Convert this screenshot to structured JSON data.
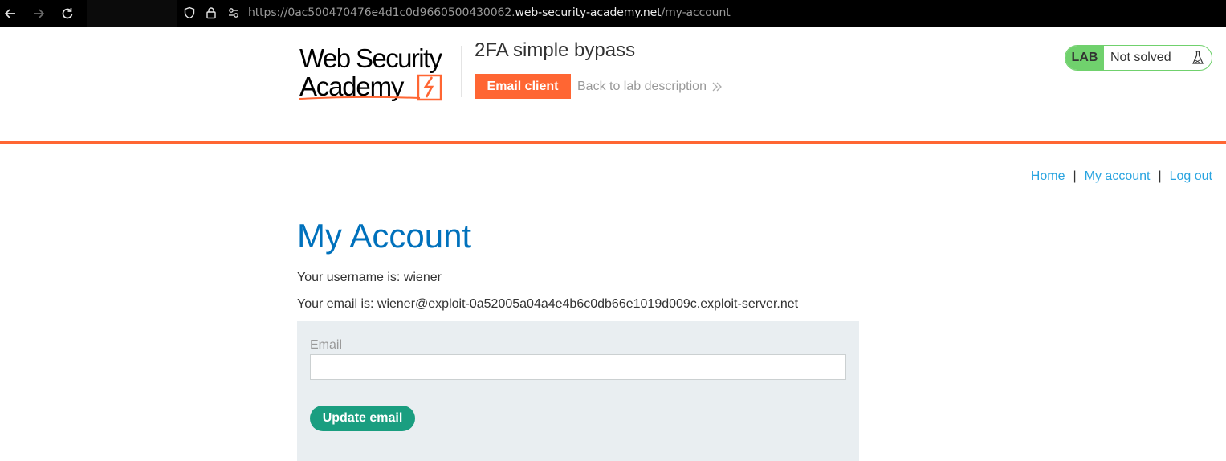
{
  "browser": {
    "url_prefix": "https://0ac500470476e4d1c0d9660500430062.",
    "url_domain": "web-security-academy.net",
    "url_path": "/my-account"
  },
  "header": {
    "logo_line1": "Web Security",
    "logo_line2": "Academy",
    "lab_title": "2FA simple bypass",
    "email_client_label": "Email client",
    "back_label": "Back to lab description",
    "lab_badge": "LAB",
    "lab_status": "Not solved"
  },
  "nav": {
    "home": "Home",
    "my_account": "My account",
    "log_out": "Log out",
    "separator": "|"
  },
  "main": {
    "title": "My Account",
    "username_line": "Your username is: wiener",
    "email_line": "Your email is: wiener@exploit-0a52005a04a4e4b6c0db66e1019d009c.exploit-server.net",
    "form": {
      "email_label": "Email",
      "email_value": "",
      "submit_label": "Update email"
    }
  },
  "colors": {
    "accent_orange": "#ff6633",
    "title_blue": "#0071bc",
    "link_blue": "#29a4e0",
    "lab_green": "#70d16d",
    "button_teal": "#1a9e80",
    "panel_gray": "#e9eef1"
  },
  "icons": [
    "back-arrow-icon",
    "forward-arrow-icon",
    "reload-icon",
    "shield-icon",
    "lock-icon",
    "site-settings-icon",
    "double-chevron-icon",
    "flask-icon",
    "logo-bolt-icon"
  ]
}
